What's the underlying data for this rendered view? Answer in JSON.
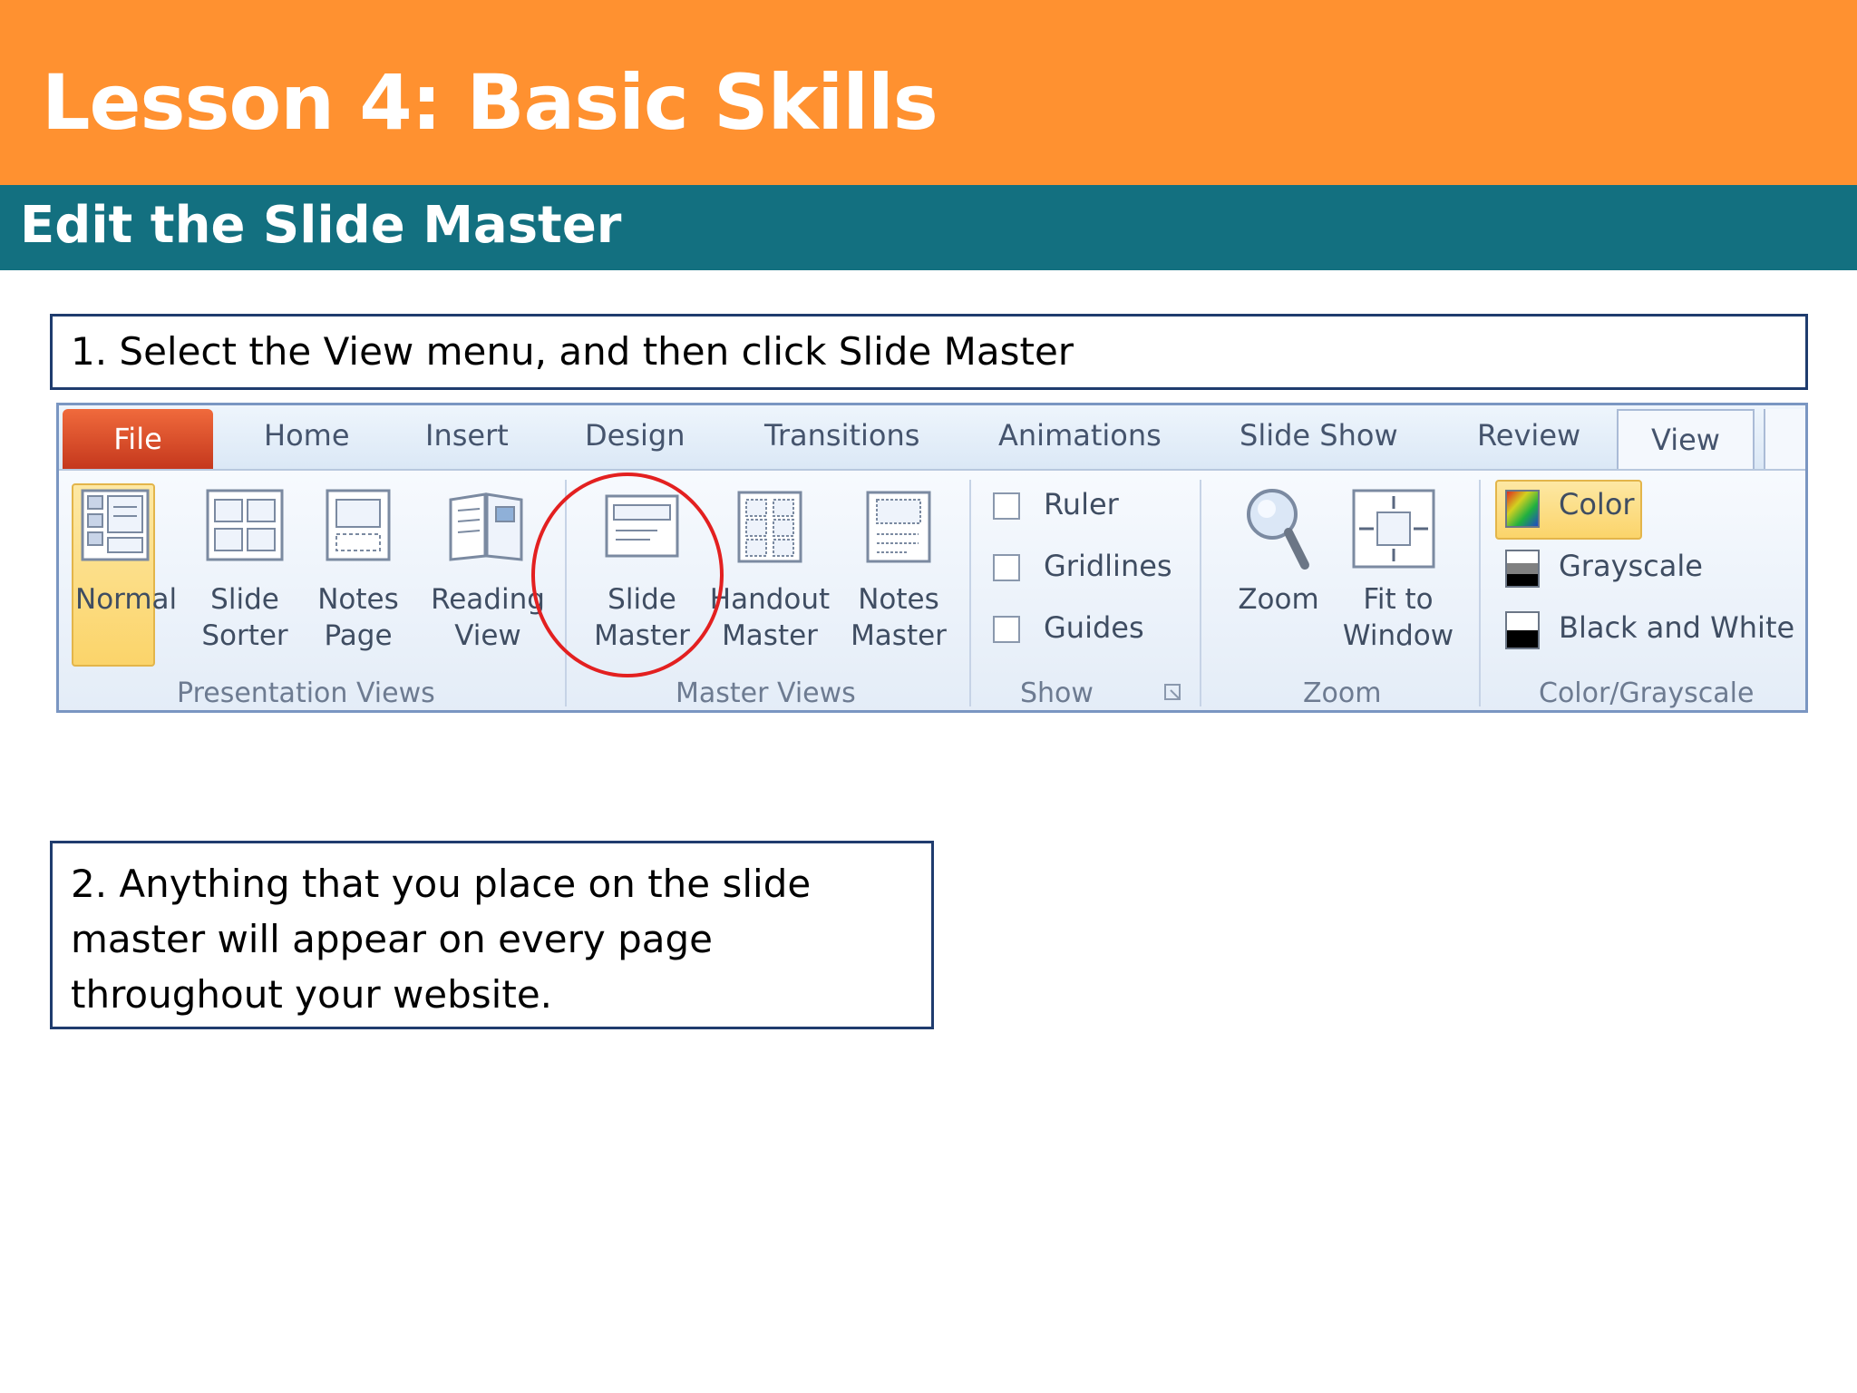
{
  "header": {
    "title": "Lesson 4: Basic Skills",
    "subtitle": "Edit the Slide Master"
  },
  "steps": {
    "step1": "1. Select the View menu, and then click Slide Master",
    "step2": "2. Anything that you place on the slide master will appear on every page throughout your website."
  },
  "ribbon": {
    "tabs": {
      "file": "File",
      "home": "Home",
      "insert": "Insert",
      "design": "Design",
      "transitions": "Transitions",
      "animations": "Animations",
      "slide_show": "Slide Show",
      "review": "Review",
      "view": "View"
    },
    "presentation_views": {
      "label": "Presentation Views",
      "normal": "Normal",
      "slide_sorter_1": "Slide",
      "slide_sorter_2": "Sorter",
      "notes_page_1": "Notes",
      "notes_page_2": "Page",
      "reading_view_1": "Reading",
      "reading_view_2": "View"
    },
    "master_views": {
      "label": "Master Views",
      "slide_master_1": "Slide",
      "slide_master_2": "Master",
      "handout_master_1": "Handout",
      "handout_master_2": "Master",
      "notes_master_1": "Notes",
      "notes_master_2": "Master"
    },
    "show": {
      "label": "Show",
      "ruler": "Ruler",
      "gridlines": "Gridlines",
      "guides": "Guides"
    },
    "zoom": {
      "label": "Zoom",
      "zoom": "Zoom",
      "fit_1": "Fit to",
      "fit_2": "Window"
    },
    "color_grayscale": {
      "label": "Color/Grayscale",
      "color": "Color",
      "grayscale": "Grayscale",
      "black_white": "Black and White"
    }
  },
  "colors": {
    "title_bar": "#ff9130",
    "subtitle_bar": "#137080",
    "highlight_circle": "#e32020"
  }
}
